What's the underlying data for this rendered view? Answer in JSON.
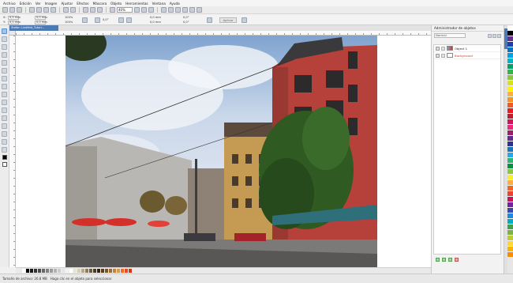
{
  "menu": [
    "Archivo",
    "Edición",
    "Ver",
    "Imagen",
    "Ajustar",
    "Efectos",
    "Máscara",
    "Objeto",
    "Herramientas",
    "Ventana",
    "Ayuda"
  ],
  "toolbar": {
    "zoom": "40%"
  },
  "propbar": {
    "x_label": "X:",
    "x_value": "0,0 mm",
    "y_label": "Y:",
    "y_value": "0,0 mm",
    "w_value": "0,0 mm",
    "h_value": "0,0 mm",
    "pct1": "100%",
    "pct2": "100%",
    "angle": "0,0°",
    "dim1": "0,0 mm",
    "dim2": "0,0 mm",
    "ang2": "0,0°",
    "ang3": "0,0°",
    "apply_label": "Aplicar"
  },
  "document": {
    "tab_title": "Stefan Lindfeld_Tutori..."
  },
  "object_manager": {
    "title": "Administrador de objetos",
    "mode": "Normal",
    "layers": [
      {
        "label": "Object 1",
        "background": false
      },
      {
        "label": "Background",
        "background": true
      }
    ]
  },
  "docker_tab_label": "Administrador de...",
  "status": {
    "file_size": "Tamaño de archivo: 26.8 MB",
    "hint": "Haga clic en el objeto para seleccionar"
  },
  "colors": {
    "accent": "#4d79b5",
    "palette_bottom": [
      "#ffffff",
      "#000000",
      "#1a1a1a",
      "#333333",
      "#4d4d4d",
      "#666666",
      "#808080",
      "#999999",
      "#b3b3b3",
      "#cccccc",
      "#e6e6e6",
      "#f2f2f2",
      "#ffffff",
      "#e9e3d3",
      "#d6cdb6",
      "#b5a88a",
      "#8c7d5e",
      "#6b5b3e",
      "#4a3b24",
      "#2e2314",
      "#5a3e1b",
      "#7a5428",
      "#9c6b35",
      "#bf8442",
      "#d99a4f",
      "#ec6b2d",
      "#e84c1e",
      "#cc3b15"
    ],
    "palette_right": [
      "#ffffff",
      "#000000",
      "#6b2e8f",
      "#1f3fa6",
      "#0078c8",
      "#00a0e6",
      "#00b5c4",
      "#00a36b",
      "#37b34a",
      "#8cc63f",
      "#d9e021",
      "#fff200",
      "#fbb040",
      "#f7941d",
      "#f15a24",
      "#ed1c24",
      "#be1e2d",
      "#d4145a",
      "#ee2a7b",
      "#9e1f63",
      "#662d91",
      "#2e3192",
      "#1b75bc",
      "#27aae1",
      "#2bb673",
      "#009444",
      "#8dc63f",
      "#f9ed32",
      "#fcb040",
      "#f26522",
      "#ef4136",
      "#c2185b",
      "#7b1fa2",
      "#3949ab",
      "#1e88e5",
      "#00acc1",
      "#43a047",
      "#7cb342",
      "#c0ca33",
      "#fdd835",
      "#ffb300",
      "#fb8c00"
    ]
  }
}
